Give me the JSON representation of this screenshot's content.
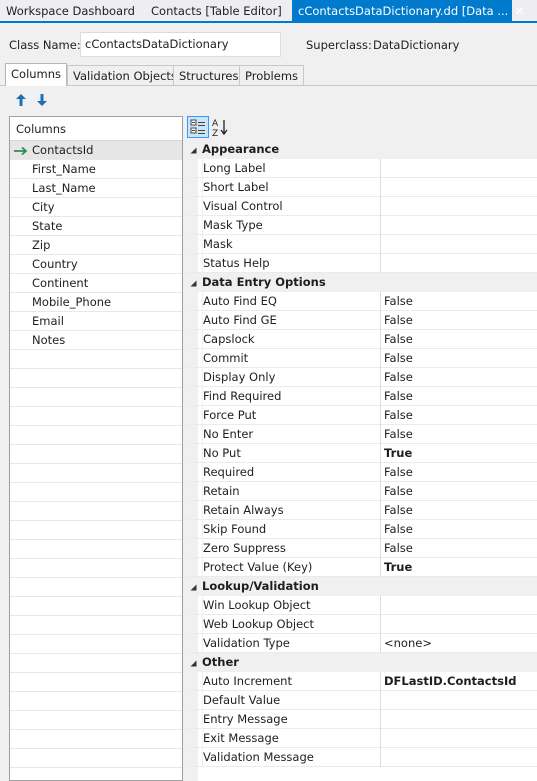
{
  "doc_tabs": [
    {
      "label": "Workspace Dashboard",
      "active": false
    },
    {
      "label": "Contacts [Table Editor]",
      "active": false
    },
    {
      "label": "cContactsDataDictionary.dd [Data ...",
      "active": true
    }
  ],
  "close_glyph": "✕",
  "class_row": {
    "class_name_label": "Class Name:",
    "class_name_value": "cContactsDataDictionary",
    "superclass_label": "Superclass:",
    "superclass_value": "DataDictionary"
  },
  "sub_tabs": [
    {
      "label": "Columns",
      "active": true
    },
    {
      "label": "Validation Objects",
      "active": false
    },
    {
      "label": "Structures",
      "active": false
    },
    {
      "label": "Problems",
      "active": false
    }
  ],
  "toolbar": {
    "move_up_icon": "arrow-up-icon",
    "move_down_icon": "arrow-down-icon"
  },
  "columns_panel": {
    "header": "Columns",
    "items": [
      "ContactsId",
      "First_Name",
      "Last_Name",
      "City",
      "State",
      "Zip",
      "Country",
      "Continent",
      "Mobile_Phone",
      "Email",
      "Notes"
    ],
    "selected_index": 0
  },
  "grid_toolbar": {
    "categorized_icon": "categorized-icon",
    "alphabetical_icon": "sort-alpha-icon",
    "alpha_glyph_top": "A",
    "alpha_glyph_bottom": "Z"
  },
  "property_grid": {
    "categories": [
      {
        "name": "Appearance",
        "properties": [
          {
            "name": "Long Label",
            "value": "",
            "bold": false
          },
          {
            "name": "Short Label",
            "value": "",
            "bold": false
          },
          {
            "name": "Visual Control",
            "value": "",
            "bold": false
          },
          {
            "name": "Mask Type",
            "value": "",
            "bold": false
          },
          {
            "name": "Mask",
            "value": "",
            "bold": false
          },
          {
            "name": "Status Help",
            "value": "",
            "bold": false
          }
        ]
      },
      {
        "name": "Data Entry Options",
        "properties": [
          {
            "name": "Auto Find EQ",
            "value": "False",
            "bold": false
          },
          {
            "name": "Auto Find GE",
            "value": "False",
            "bold": false
          },
          {
            "name": "Capslock",
            "value": "False",
            "bold": false
          },
          {
            "name": "Commit",
            "value": "False",
            "bold": false
          },
          {
            "name": "Display Only",
            "value": "False",
            "bold": false
          },
          {
            "name": "Find Required",
            "value": "False",
            "bold": false
          },
          {
            "name": "Force Put",
            "value": "False",
            "bold": false
          },
          {
            "name": "No Enter",
            "value": "False",
            "bold": false
          },
          {
            "name": "No Put",
            "value": "True",
            "bold": true
          },
          {
            "name": "Required",
            "value": "False",
            "bold": false
          },
          {
            "name": "Retain",
            "value": "False",
            "bold": false
          },
          {
            "name": "Retain Always",
            "value": "False",
            "bold": false
          },
          {
            "name": "Skip Found",
            "value": "False",
            "bold": false
          },
          {
            "name": "Zero Suppress",
            "value": "False",
            "bold": false
          },
          {
            "name": "Protect Value (Key)",
            "value": "True",
            "bold": true
          }
        ]
      },
      {
        "name": "Lookup/Validation",
        "properties": [
          {
            "name": "Win Lookup Object",
            "value": "",
            "bold": false
          },
          {
            "name": "Web Lookup Object",
            "value": "",
            "bold": false
          },
          {
            "name": "Validation Type",
            "value": "<none>",
            "bold": false
          }
        ]
      },
      {
        "name": "Other",
        "properties": [
          {
            "name": "Auto Increment",
            "value": "DFLastID.ContactsId",
            "bold": true
          },
          {
            "name": "Default Value",
            "value": "",
            "bold": false
          },
          {
            "name": "Entry Message",
            "value": "",
            "bold": false
          },
          {
            "name": "Exit Message",
            "value": "",
            "bold": false
          },
          {
            "name": "Validation Message",
            "value": "",
            "bold": false
          }
        ]
      }
    ]
  },
  "colors": {
    "accent": "#007acc",
    "selection_arrow": "#2e8b57",
    "toolbar_arrow": "#1f6fb5"
  }
}
